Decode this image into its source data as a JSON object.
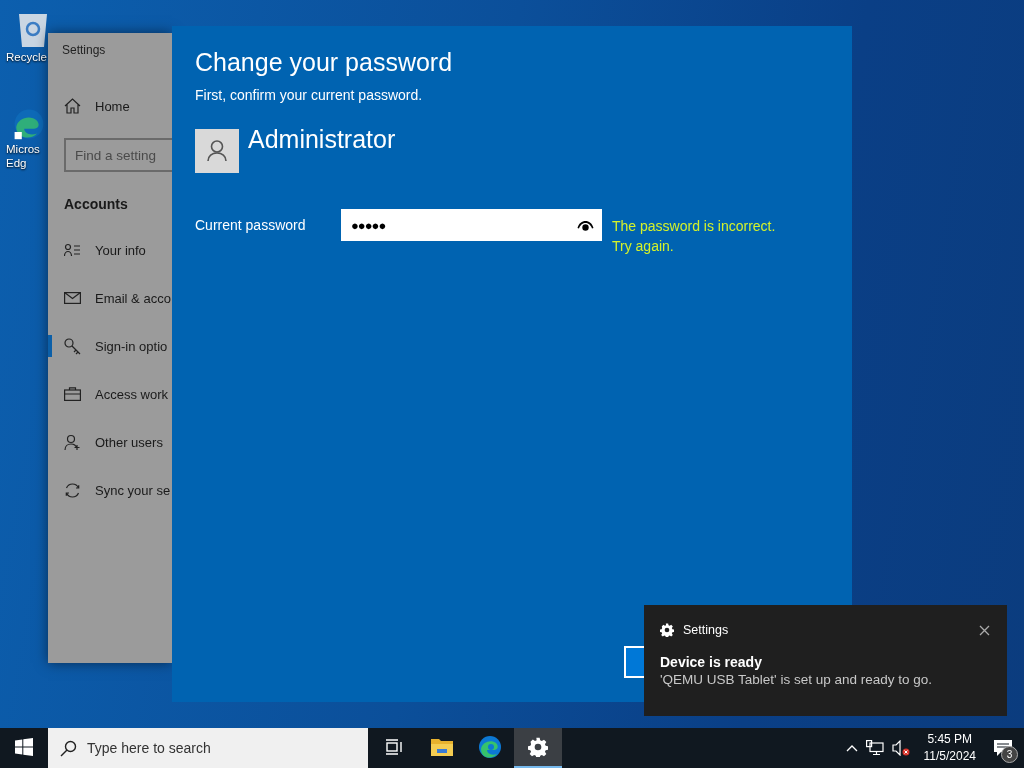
{
  "desktop_icons": [
    {
      "lines": [
        "Recycle"
      ]
    },
    {
      "lines": [
        "Micros",
        "Edg"
      ]
    }
  ],
  "settings_window": {
    "title": "Settings",
    "home": "Home",
    "search": {
      "placeholder": "Find a setting"
    },
    "section": "Accounts",
    "items": [
      {
        "label": "Your info",
        "selected": false
      },
      {
        "label": "Email & acco",
        "selected": false
      },
      {
        "label": "Sign-in optio",
        "selected": true
      },
      {
        "label": "Access work",
        "selected": false
      },
      {
        "label": "Other users",
        "selected": false
      },
      {
        "label": "Sync your se",
        "selected": false
      }
    ]
  },
  "dialog": {
    "title": "Change your password",
    "subtitle": "First, confirm your current password.",
    "account": "Administrator",
    "field_label": "Current password",
    "password": {
      "value": "●●●●●"
    },
    "error": "The password is incorrect. Try again."
  },
  "toast": {
    "app": "Settings",
    "title": "Device is ready",
    "body": "'QEMU USB Tablet' is set up and ready to go."
  },
  "taskbar": {
    "search": {
      "placeholder": "Type here to search"
    },
    "apps": [
      {
        "kind": "taskview",
        "selected": false
      },
      {
        "kind": "explorer",
        "selected": false
      },
      {
        "kind": "edge",
        "selected": false
      },
      {
        "kind": "settings",
        "selected": true
      }
    ],
    "time": "5:45 PM",
    "date": "11/5/2024",
    "notifications": "3"
  }
}
